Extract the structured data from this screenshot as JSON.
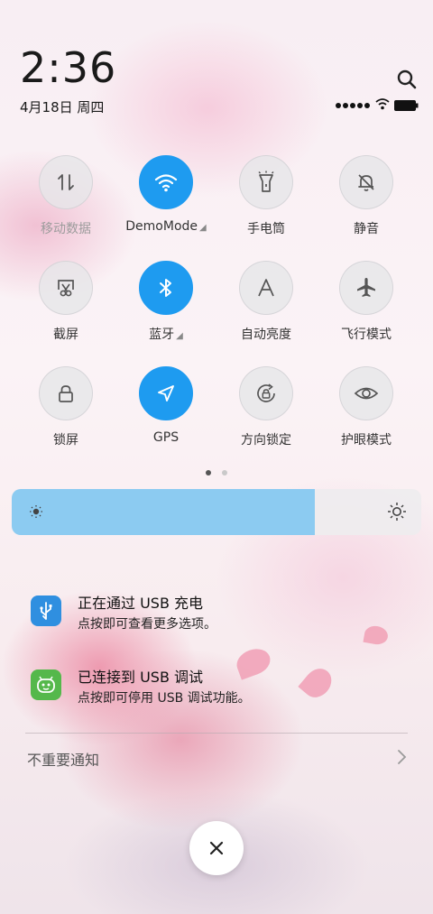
{
  "status": {
    "time": "2:36",
    "date": "4月18日 周四"
  },
  "toggles": [
    {
      "label": "移动数据",
      "icon": "mobile-data-icon",
      "on": false
    },
    {
      "label": "DemoMode",
      "icon": "wifi-icon",
      "on": true
    },
    {
      "label": "手电筒",
      "icon": "flashlight-icon",
      "on": false
    },
    {
      "label": "静音",
      "icon": "mute-bell-icon",
      "on": false
    },
    {
      "label": "截屏",
      "icon": "screenshot-icon",
      "on": false
    },
    {
      "label": "蓝牙",
      "icon": "bluetooth-icon",
      "on": true
    },
    {
      "label": "自动亮度",
      "icon": "auto-brightness-icon",
      "on": false
    },
    {
      "label": "飞行模式",
      "icon": "airplane-icon",
      "on": false
    },
    {
      "label": "锁屏",
      "icon": "lock-icon",
      "on": false
    },
    {
      "label": "GPS",
      "icon": "gps-icon",
      "on": true
    },
    {
      "label": "方向锁定",
      "icon": "rotation-lock-icon",
      "on": false
    },
    {
      "label": "护眼模式",
      "icon": "eye-icon",
      "on": false
    }
  ],
  "pager": {
    "current": 1,
    "total": 2
  },
  "brightness": {
    "level": 0.74
  },
  "colors": {
    "accent": "#1e9bf0",
    "slider_fill": "#8ccbf1",
    "usb_icon": "#2f8fe0",
    "debug_icon": "#55b84b"
  },
  "notifications": [
    {
      "title": "正在通过 USB 充电",
      "body": "点按即可查看更多选项。",
      "icon": "usb-icon"
    },
    {
      "title": "已连接到 USB 调试",
      "body": "点按即可停用 USB 调试功能。",
      "icon": "android-debug-icon"
    }
  ],
  "unimportant_label": "不重要通知"
}
